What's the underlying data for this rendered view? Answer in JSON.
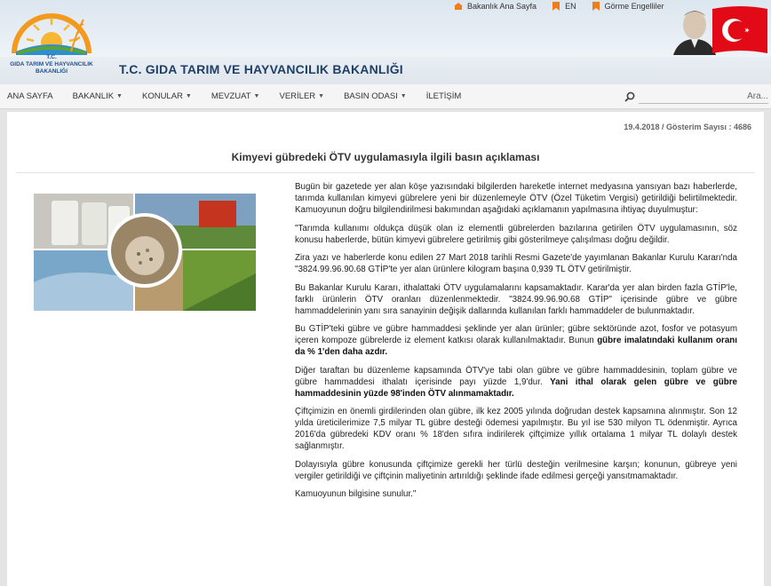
{
  "header": {
    "logo_text_line1": "T.C.",
    "logo_text_line2": "GIDA TARIM VE HAYVANCILIK",
    "logo_text_line3": "BAKANLIĞI",
    "title": "T.C. GIDA TARIM VE HAYVANCILIK BAKANLIĞI",
    "top_links": [
      {
        "label": "Bakanlık Ana Sayfa",
        "icon": "home-icon"
      },
      {
        "label": "EN",
        "icon": "bookmark-icon"
      },
      {
        "label": "Görme Engelliler",
        "icon": "bookmark-icon"
      }
    ]
  },
  "nav": {
    "items": [
      {
        "label": "ANA SAYFA",
        "dropdown": false
      },
      {
        "label": "BAKANLIK",
        "dropdown": true
      },
      {
        "label": "KONULAR",
        "dropdown": true
      },
      {
        "label": "MEVZUAT",
        "dropdown": true
      },
      {
        "label": "VERİLER",
        "dropdown": true
      },
      {
        "label": "BASIN ODASI",
        "dropdown": true
      },
      {
        "label": "İLETİŞİM",
        "dropdown": false
      }
    ],
    "search_placeholder": "Ara..."
  },
  "article": {
    "meta": "19.4.2018 / Gösterim Sayısı : 4686",
    "title": "Kimyevi gübredeki ÖTV uygulamasıyla ilgili basın açıklaması",
    "p1": "Bugün bir gazetede yer alan köşe yazısındaki bilgilerden hareketle internet medyasına yansıyan bazı haberlerde, tarımda kullanılan kimyevi gübrelere yeni bir düzenlemeyle ÖTV (Özel Tüketim Vergisi) getirildiği belirtilmektedir. Kamuoyunun doğru bilgilendirilmesi bakımından aşağıdaki açıklamanın yapılmasına ihtiyaç duyulmuştur:",
    "p2": "\"Tarımda kullanımı oldukça düşük olan iz elementli gübrelerden bazılarına getirilen ÖTV uygulamasının, söz konusu haberlerde, bütün kimyevi gübrelere getirilmiş gibi gösterilmeye çalışılması doğru değildir.",
    "p3": "Zira yazı ve haberlerde konu edilen 27 Mart 2018 tarihli Resmi Gazete'de yayımlanan Bakanlar Kurulu Kararı'nda \"3824.99.96.90.68 GTİP'te yer alan ürünlere kilogram başına 0,939 TL ÖTV getirilmiştir.",
    "p4": "Bu Bakanlar Kurulu Kararı, ithalattaki ÖTV uygulamalarını kapsamaktadır. Karar'da yer alan birden fazla GTİP'le, farklı ürünlerin ÖTV oranları düzenlenmektedir. \"3824.99.96.90.68 GTİP\" içerisinde gübre ve gübre hammaddelerinin yanı sıra sanayinin değişik dallarında kullanılan farklı hammaddeler de bulunmaktadır.",
    "p5_plain": "Bu GTİP'teki gübre ve gübre hammaddesi şeklinde yer alan ürünler; gübre sektöründe azot, fosfor ve potasyum içeren kompoze gübrelerde iz element katkısı olarak kullanılmaktadır. Bunun ",
    "p5_bold": "gübre imalatındaki kullanım oranı da % 1'den daha azdır.",
    "p6_plain": "Diğer taraftan bu düzenleme kapsamında ÖTV'ye tabi olan gübre ve gübre hammaddesinin, toplam gübre ve gübre hammaddesi ithalatı içerisinde payı yüzde 1,9'dur. ",
    "p6_bold": "Yani ithal olarak gelen gübre ve gübre hammaddesinin yüzde 98'inden ÖTV alınmamaktadır.",
    "p7": "Çiftçimizin en önemli girdilerinden olan gübre, ilk kez 2005 yılında doğrudan destek kapsamına alınmıştır. Son 12 yılda üreticilerimize 7,5 milyar TL gübre desteği ödemesi yapılmıştır. Bu yıl ise 530 milyon TL ödenmiştir. Ayrıca 2016'da gübredeki KDV oranı % 18'den sıfıra indirilerek çiftçimize yıllık ortalama 1 milyar TL dolaylı destek sağlanmıştır.",
    "p8": "Dolayısıyla gübre konusunda çiftçimize gerekli her türlü desteğin verilmesine karşın; konunun, gübreye yeni vergiler getirildiği ve çiftçinin maliyetinin artırıldığı şeklinde ifade edilmesi gerçeği yansıtmamaktadır.",
    "p9": "Kamuoyunun bilgisine sunulur.\""
  },
  "colors": {
    "title_blue": "#1f3f66",
    "logo_orange": "#f39a1e",
    "logo_green": "#5aa23a",
    "flag_red": "#e30a17"
  }
}
